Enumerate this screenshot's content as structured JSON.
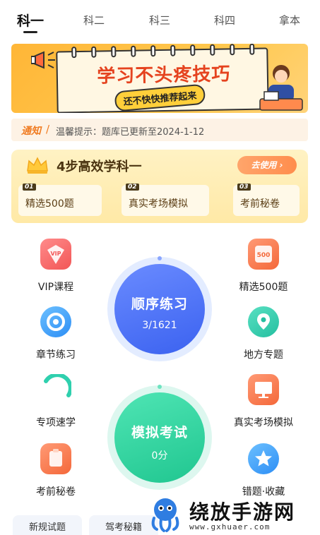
{
  "tabs": [
    {
      "label": "科一",
      "active": true
    },
    {
      "label": "科二",
      "active": false
    },
    {
      "label": "科三",
      "active": false
    },
    {
      "label": "科四",
      "active": false
    },
    {
      "label": "拿本",
      "active": false
    }
  ],
  "banner": {
    "title": "学习不头疼技巧",
    "subtitle": "还不快快推荐起来"
  },
  "notice": {
    "tag": "通知",
    "text": "温馨提示：题库已更新至2024-1-12"
  },
  "steps": {
    "title": "4步高效学科一",
    "button": "去使用",
    "items": [
      {
        "num": "01",
        "label": "精选500题"
      },
      {
        "num": "02",
        "label": "真实考场模拟"
      },
      {
        "num": "03",
        "label": "考前秘卷"
      }
    ]
  },
  "left_items": [
    {
      "label": "VIP课程",
      "icon": "vip-icon"
    },
    {
      "label": "章节练习",
      "icon": "chapter-icon"
    },
    {
      "label": "专项速学",
      "icon": "special-icon"
    },
    {
      "label": "考前秘卷",
      "icon": "clipboard-icon"
    }
  ],
  "right_items": [
    {
      "label": "精选500题",
      "icon": "500-icon"
    },
    {
      "label": "地方专题",
      "icon": "location-icon"
    },
    {
      "label": "真实考场模拟",
      "icon": "monitor-icon"
    },
    {
      "label": "错题·收藏",
      "icon": "star-icon"
    }
  ],
  "practice": {
    "title": "顺序练习",
    "progress": "3/1621"
  },
  "exam": {
    "title": "模拟考试",
    "score": "0分"
  },
  "bottom": {
    "btn1": "新规试题",
    "btn2": "驾考秘籍"
  },
  "watermark": {
    "text": "绕放手游网",
    "url": "www.gxhuaer.com"
  },
  "colors": {
    "accent_blue": "#3b62f0",
    "accent_green": "#20c690",
    "notice_orange": "#f07c22"
  }
}
